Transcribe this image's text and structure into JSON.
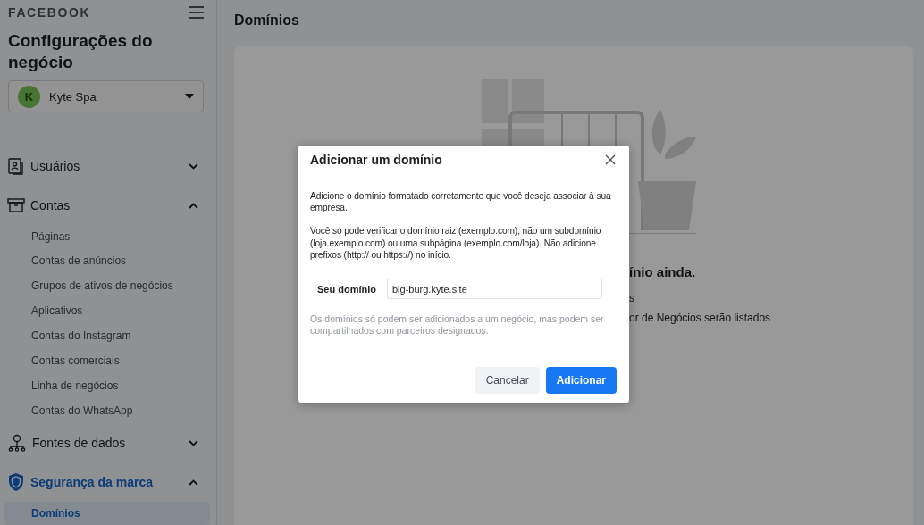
{
  "sidebar": {
    "brand": "FACEBOOK",
    "title": "Configurações do negócio",
    "account": {
      "initial": "K",
      "name": "Kyte Spa"
    },
    "sections": [
      {
        "label": "Usuários",
        "expanded": false,
        "selected": false
      },
      {
        "label": "Contas",
        "expanded": true,
        "selected": false,
        "children": [
          {
            "label": "Páginas",
            "selected": false
          },
          {
            "label": "Contas de anúncios",
            "selected": false
          },
          {
            "label": "Grupos de ativos de negócios",
            "selected": false
          },
          {
            "label": "Aplicativos",
            "selected": false
          },
          {
            "label": "Contas do Instagram",
            "selected": false
          },
          {
            "label": "Contas comerciais",
            "selected": false
          },
          {
            "label": "Linha de negócios",
            "selected": false
          },
          {
            "label": "Contas do WhatsApp",
            "selected": false
          }
        ]
      },
      {
        "label": "Fontes de dados",
        "expanded": false,
        "selected": false
      },
      {
        "label": "Segurança da marca",
        "expanded": true,
        "selected": true,
        "children": [
          {
            "label": "Domínios",
            "selected": true
          }
        ]
      }
    ]
  },
  "main": {
    "title": "Domínios",
    "empty_state": {
      "heading": "ínio ainda.",
      "line_1": "s",
      "line_2": "or de Negócios serão listados"
    }
  },
  "dialog": {
    "title": "Adicionar um domínio",
    "paragraphs": [
      "Adicione o domínio formatado corretamente que você deseja associar à sua empresa.",
      "Você só pode verificar o domínio raiz (exemplo.com), não um subdomínio (loja.exemplo.com) ou uma subpágina (exemplo.com/loja). Não adicione prefixos (http:// ou https://) no início."
    ],
    "field": {
      "label": "Seu domínio",
      "value": "big-burg.kyte.site"
    },
    "note": "Os domínios só podem ser adicionados a um negócio, mas podem ser compartilhados com parceiros designados.",
    "buttons": [
      {
        "label": "Cancelar",
        "kind": "secondary"
      },
      {
        "label": "Adicionar",
        "kind": "primary"
      }
    ]
  }
}
